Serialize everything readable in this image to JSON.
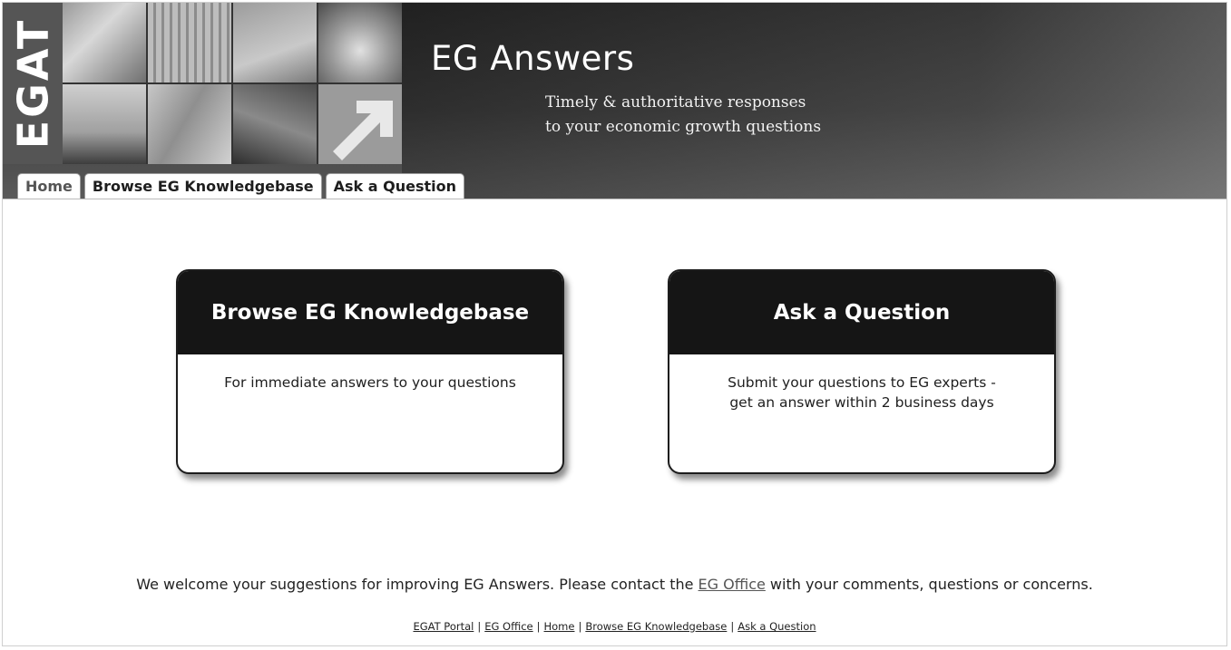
{
  "banner": {
    "logo_text": "EGAT",
    "title": "EG Answers",
    "tagline_line1": "Timely & authoritative responses",
    "tagline_line2": "to your economic growth questions"
  },
  "tabs": [
    {
      "label": "Home"
    },
    {
      "label": "Browse EG Knowledgebase"
    },
    {
      "label": "Ask a Question"
    }
  ],
  "cards": {
    "browse": {
      "title": "Browse EG Knowledgebase",
      "description": "For immediate answers to your questions"
    },
    "ask": {
      "title": "Ask a Question",
      "description_line1": "Submit your questions to EG experts -",
      "description_line2": "get an answer within 2 business days"
    }
  },
  "welcome": {
    "text_before": "We welcome your suggestions for improving EG Answers. Please contact the ",
    "link": "EG Office",
    "text_after": " with your comments, questions or concerns."
  },
  "footer_links": {
    "separator": "|",
    "items": [
      "EGAT Portal",
      "EG Office",
      "Home",
      "Browse EG Knowledgebase",
      "Ask a Question"
    ]
  }
}
